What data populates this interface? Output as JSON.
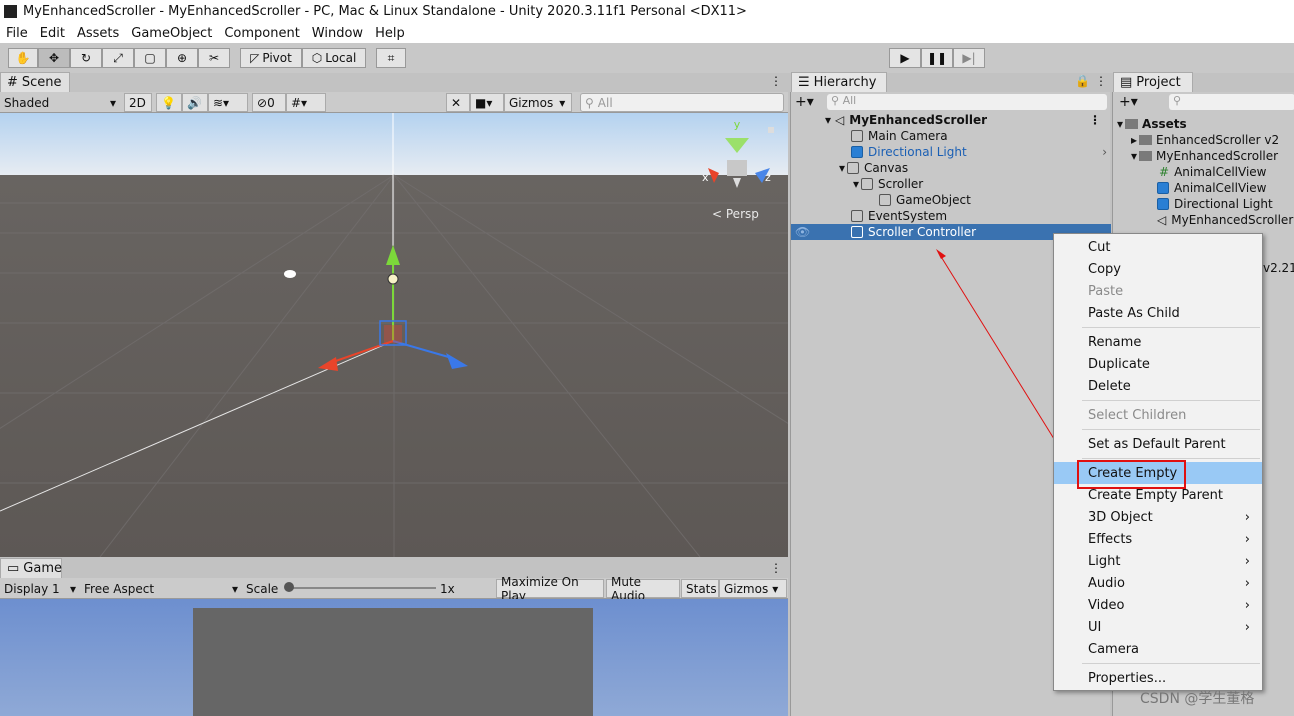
{
  "window": {
    "title": "MyEnhancedScroller - MyEnhancedScroller - PC, Mac & Linux Standalone - Unity 2020.3.11f1 Personal <DX11>"
  },
  "menu": [
    "File",
    "Edit",
    "Assets",
    "GameObject",
    "Component",
    "Window",
    "Help"
  ],
  "toolbar": {
    "pivot": "Pivot",
    "local": "Local"
  },
  "scene": {
    "tab": "Scene",
    "shading": "Shaded",
    "mode2d": "2D",
    "hidden_count": "0",
    "gizmos": "Gizmos",
    "search_placeholder": "All",
    "persp": "Persp",
    "axis_x": "x",
    "axis_y": "y",
    "axis_z": "z"
  },
  "game": {
    "tab": "Game",
    "display": "Display 1",
    "aspect": "Free Aspect",
    "scale_label": "Scale",
    "scale_value": "1x",
    "maximize": "Maximize On Play",
    "mute": "Mute Audio",
    "stats": "Stats",
    "gizmos": "Gizmos"
  },
  "hierarchy": {
    "tab": "Hierarchy",
    "search_placeholder": "All",
    "items": [
      "MyEnhancedScroller",
      "Main Camera",
      "Directional Light",
      "Canvas",
      "Scroller",
      "GameObject",
      "EventSystem",
      "Scroller Controller"
    ]
  },
  "project": {
    "tab": "Project",
    "items": [
      "Assets",
      "EnhancedScroller v2",
      "MyEnhancedScroller",
      "AnimalCellView",
      "AnimalCellView",
      "Directional Light",
      "MyEnhancedScroller",
      "v2.21"
    ]
  },
  "context_menu": {
    "items": [
      "Cut",
      "Copy",
      "Paste",
      "Paste As Child",
      "Rename",
      "Duplicate",
      "Delete",
      "Select Children",
      "Set as Default Parent",
      "Create Empty",
      "Create Empty Parent",
      "3D Object",
      "Effects",
      "Light",
      "Audio",
      "Video",
      "UI",
      "Camera",
      "Properties..."
    ]
  },
  "watermark": "CSDN @学生董格",
  "colors": {
    "selection": "#3a72b0",
    "highlight": "#99c9f5",
    "annotation": "#e01010"
  }
}
